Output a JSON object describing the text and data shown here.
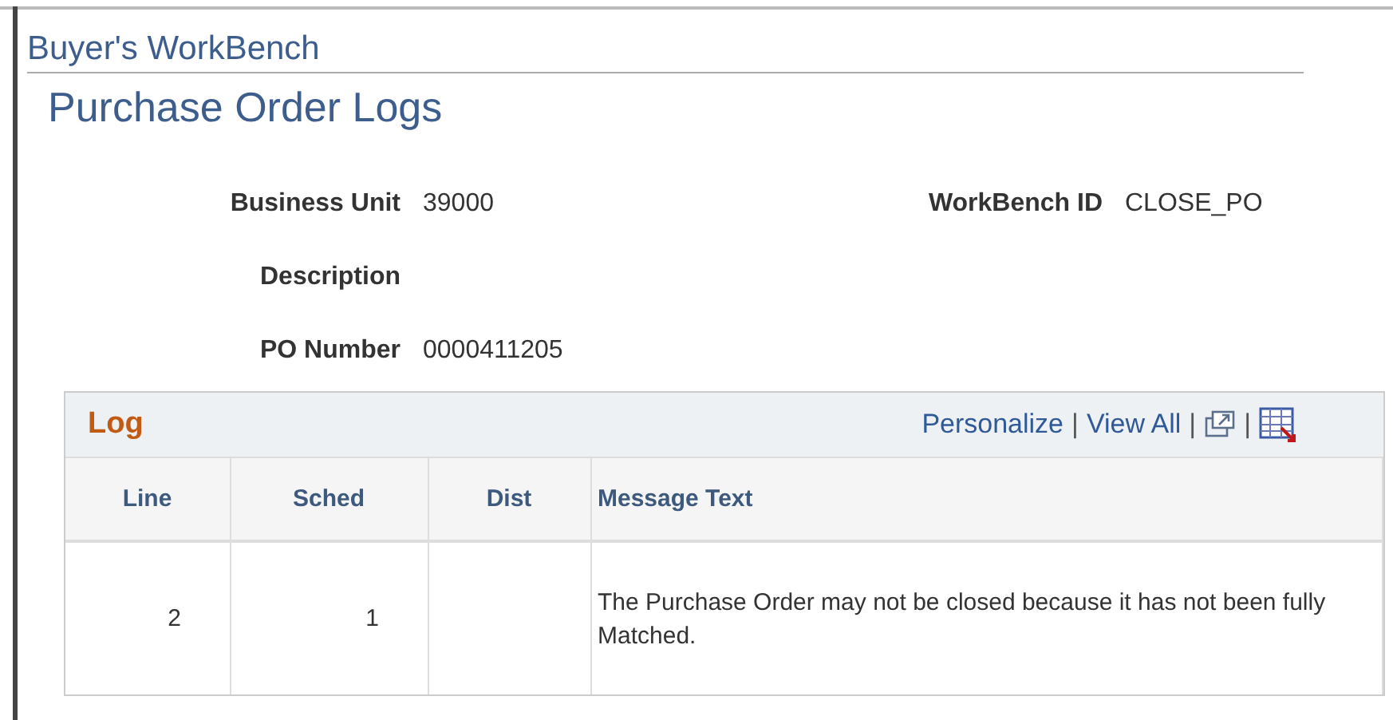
{
  "breadcrumb": "Buyer's WorkBench",
  "title": "Purchase Order Logs",
  "fields": [
    {
      "label": "Business Unit",
      "value": "39000"
    },
    {
      "label": "WorkBench ID",
      "value": "CLOSE_PO"
    },
    {
      "label": "Description"
    },
    {
      "label": "PO Number",
      "value": "0000411205"
    }
  ],
  "grid": {
    "title": "Log",
    "links": [
      "Personalize",
      "View All"
    ],
    "separator": "|",
    "columns": [
      {
        "label": "Line"
      },
      {
        "label": "Sched"
      },
      {
        "label": "Dist"
      },
      {
        "label": "Message Text"
      }
    ],
    "rows": [
      [
        "2",
        "1",
        "",
        "The Purchase Order may not be closed because it has not been fully Matched."
      ]
    ]
  }
}
